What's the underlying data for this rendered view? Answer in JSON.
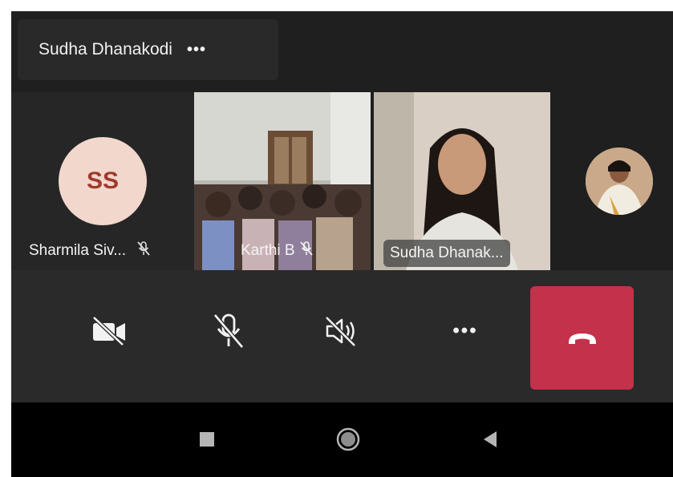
{
  "header": {
    "title": "Sudha Dhanakodi",
    "more_label": "•••"
  },
  "participants": [
    {
      "name": "Sharmila Siv...",
      "initials": "SS",
      "muted": true,
      "avatar_bg": "#f2d7cd",
      "initials_color": "#9e3a2d"
    },
    {
      "name": "Karthi B",
      "muted": true
    },
    {
      "name": "Sudha Dhanak..."
    },
    {
      "name": "",
      "avatar": "photo"
    }
  ],
  "controls": {
    "video": {
      "state": "off",
      "icon": "video-off-icon"
    },
    "mic": {
      "state": "off",
      "icon": "mic-off-icon"
    },
    "speaker": {
      "state": "off",
      "icon": "speaker-off-icon"
    },
    "more_label": "•••",
    "hangup": {
      "icon": "hang-up-icon",
      "color": "#c4314b"
    }
  },
  "system_nav": {
    "recents": "square-icon",
    "home": "circle-icon",
    "back": "triangle-back-icon"
  }
}
